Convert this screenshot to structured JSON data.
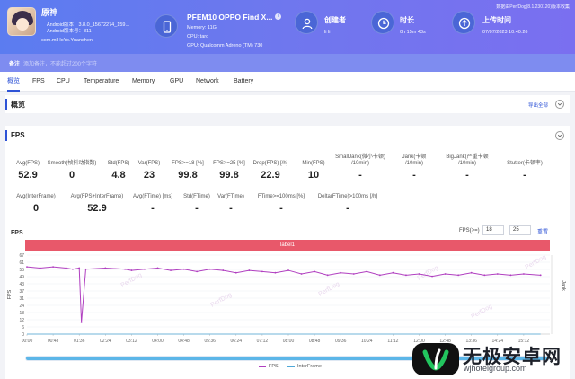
{
  "colors": {
    "header_gradient_start": "#5b7cf0",
    "header_gradient_end": "#7a6ff0",
    "accent": "#2e53d6",
    "fps_line": "#b03fc0",
    "interframe_line": "#4fa8d8",
    "label_bar": "#e8586a"
  },
  "header": {
    "app_name": "原神",
    "app_lines": [
      "Android版本：3.8.0_15672274_159...",
      "Android版本号：811"
    ],
    "app_package": "com.miHoYo.Yuanshen",
    "device_title": "PFEM10 OPPO Find X...",
    "device_memory": "Memory: 11G",
    "device_cpu": "CPU: taro",
    "device_gpu": "GPU: Qualcomm Adreno (TM) 730",
    "creator_label": "创建者",
    "creator_value": "li li",
    "duration_label": "时长",
    "duration_value": "0h 15m 43s",
    "upload_label": "上传时间",
    "upload_value": "07/07/2023 10:40:26",
    "version_text": "数据由PerfDog(8.1.230120)版本收集",
    "note_label": "备注",
    "note_placeholder": "添加备注，不能超过200个字符"
  },
  "tabs": [
    "概览",
    "FPS",
    "CPU",
    "Temperature",
    "Memory",
    "GPU",
    "Network",
    "Battery"
  ],
  "overview": {
    "title": "概览",
    "export_label": "导出全部"
  },
  "fps_panel": {
    "title": "FPS",
    "metrics_row1": [
      {
        "label": "Avg(FPS)",
        "value": "52.9"
      },
      {
        "label": "Smooth(帧抖动指数)",
        "value": "0"
      },
      {
        "label": "Std(FPS)",
        "value": "4.8"
      },
      {
        "label": "Var(FPS)",
        "value": "23"
      },
      {
        "label": "FPS>=18 [%]",
        "value": "99.8"
      },
      {
        "label": "FPS>=25 [%]",
        "value": "99.8"
      },
      {
        "label": "Drop(FPS) [/h]",
        "value": "22.9"
      },
      {
        "label": "Min(FPS)",
        "value": "10"
      },
      {
        "label": "SmallJank(微小卡顿)\n/10min)",
        "value": "-"
      },
      {
        "label": "Jank(卡顿\n/10min)",
        "value": "-"
      },
      {
        "label": "BigJank(严重卡顿\n/10min)",
        "value": "-"
      },
      {
        "label": "Stutter(卡顿率)",
        "value": "-"
      }
    ],
    "metrics_row2": [
      {
        "label": "Avg(InterFrame)",
        "value": "0"
      },
      {
        "label": "Avg(FPS+InterFrame)",
        "value": "52.9"
      },
      {
        "label": "Avg(FTime) [ms]",
        "value": "-"
      },
      {
        "label": "Std(FTime)",
        "value": "-"
      },
      {
        "label": "Var(FTime)",
        "value": "-"
      },
      {
        "label": "FTime>=100ms [%]",
        "value": "-"
      },
      {
        "label": "Delta(FTime)>100ms [/h]",
        "value": "-"
      }
    ],
    "chart_title": "FPS",
    "threshold_label": "FPS(>=)",
    "threshold_1": "18",
    "threshold_2": "25",
    "settings_link": "重置",
    "label_text": "label1",
    "watermark": "PerfDog"
  },
  "chart_data": {
    "type": "line",
    "ylabel": "FPS",
    "right_ylabel": "Jank",
    "ylim": [
      0,
      67
    ],
    "y_ticks": [
      "67",
      "61",
      "55",
      "49",
      "43",
      "37",
      "31",
      "24",
      "18",
      "12",
      "6",
      "0"
    ],
    "x_ticks": [
      "00:00",
      "00:48",
      "01:36",
      "02:24",
      "03:12",
      "04:00",
      "04:48",
      "05:36",
      "06:24",
      "07:12",
      "08:00",
      "08:48",
      "09:36",
      "10:24",
      "11:12",
      "12:00",
      "12:48",
      "13:36",
      "14:24",
      "15:12"
    ],
    "legend_placement": "bottom-center",
    "series": [
      {
        "name": "FPS",
        "x": [
          "00:00",
          "00:24",
          "00:48",
          "01:12",
          "01:24",
          "01:36",
          "01:40",
          "01:48",
          "02:24",
          "03:00",
          "03:12",
          "03:36",
          "04:00",
          "04:24",
          "04:48",
          "05:12",
          "05:36",
          "06:00",
          "06:24",
          "06:48",
          "07:12",
          "07:36",
          "08:00",
          "08:24",
          "08:48",
          "09:12",
          "09:36",
          "10:00",
          "10:24",
          "10:48",
          "11:12",
          "11:36",
          "12:00",
          "12:24",
          "12:48",
          "13:12",
          "13:36",
          "14:00",
          "14:24",
          "14:48",
          "15:12",
          "15:43"
        ],
        "values": [
          57,
          56,
          57,
          56,
          55,
          56,
          10,
          55,
          56,
          55,
          54,
          55,
          56,
          54,
          55,
          53,
          55,
          54,
          52,
          54,
          53,
          52,
          54,
          51,
          53,
          50,
          52,
          51,
          53,
          50,
          52,
          50,
          51,
          49,
          51,
          50,
          52,
          50,
          51,
          50,
          51,
          50
        ]
      },
      {
        "name": "InterFrame",
        "x": [
          "00:00",
          "15:43"
        ],
        "values": [
          0,
          0
        ]
      }
    ]
  },
  "watermark_site": {
    "name": "无极安卓网",
    "url": "wjhotelgroup.com"
  }
}
